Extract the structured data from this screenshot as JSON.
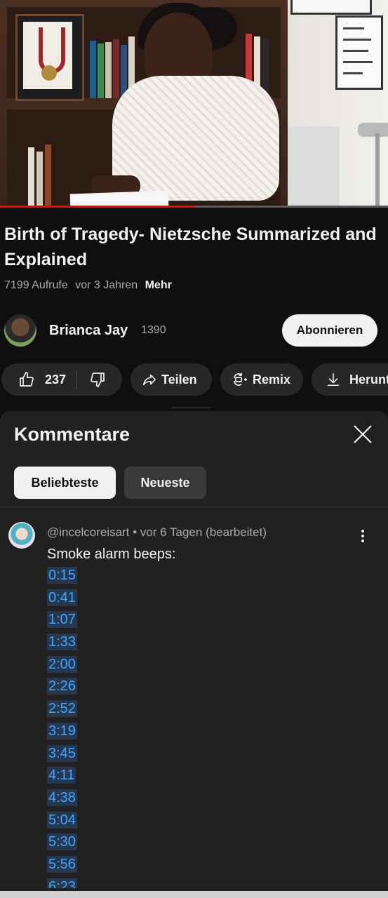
{
  "video": {
    "progress": 0.5
  },
  "info": {
    "title": "Birth of Tragedy- Nietzsche Summarized and Explained",
    "views": "7199 Aufrufe",
    "age": "vor 3 Jahren",
    "more_label": "Mehr"
  },
  "channel": {
    "name": "Brianca Jay",
    "subscribers": "1390",
    "subscribe_label": "Abonnieren"
  },
  "actions": {
    "like_count": "237",
    "share_label": "Teilen",
    "remix_label": "Remix",
    "download_label": "Herunt"
  },
  "comments": {
    "title": "Kommentare",
    "tabs": [
      {
        "label": "Beliebteste",
        "active": true
      },
      {
        "label": "Neueste",
        "active": false
      }
    ],
    "items": [
      {
        "header": "@incelcoreisart • vor 6 Tagen (bearbeitet)",
        "text": "Smoke alarm beeps:",
        "timestamps": [
          "0:15",
          "0:41",
          "1:07",
          "1:33",
          "2:00",
          "2:26",
          "2:52",
          "3:19",
          "3:45",
          "4:11",
          "4:38",
          "5:04",
          "5:30",
          "5:56",
          "6:23"
        ]
      }
    ]
  },
  "colors": {
    "background": "#0f0f0f",
    "sheet": "#212121",
    "link": "#3ea6ff",
    "progress": "#ff0000"
  }
}
